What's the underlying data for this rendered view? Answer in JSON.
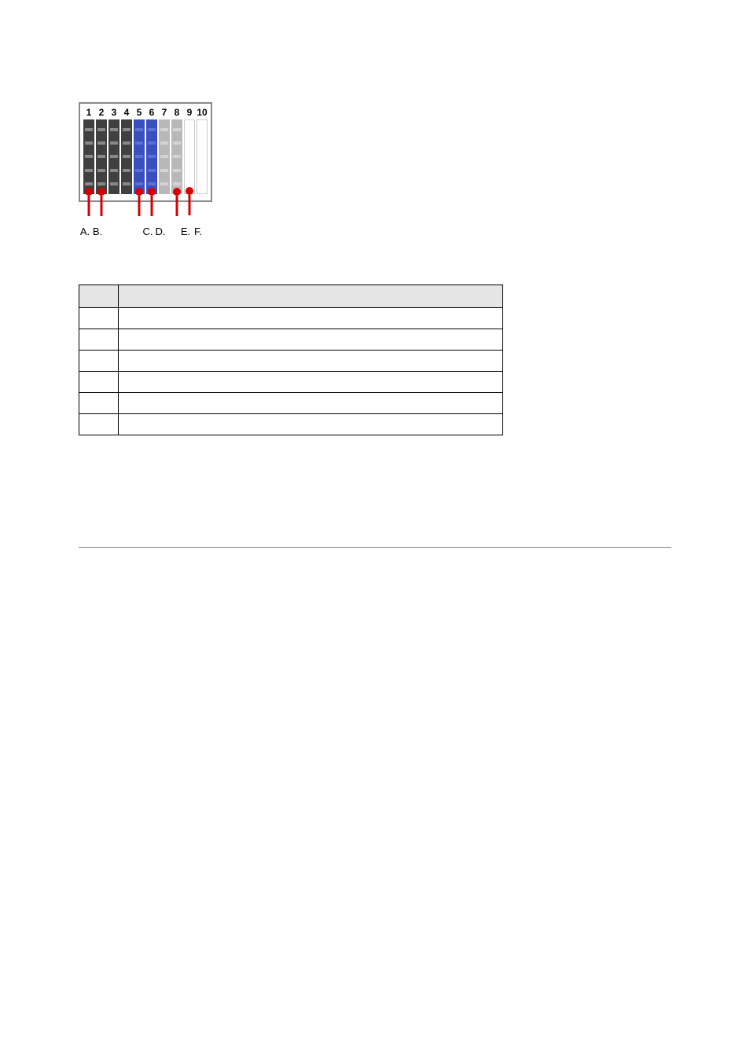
{
  "slots": [
    "1",
    "2",
    "3",
    "4",
    "5",
    "6",
    "7",
    "8",
    "9",
    "10"
  ],
  "pin_labels": {
    "a": "A.",
    "b": "B.",
    "c": "C.",
    "d": "D.",
    "e": "E.",
    "f": "F."
  },
  "table": {
    "header": [
      "",
      ""
    ],
    "rows": [
      [
        "",
        ""
      ],
      [
        "",
        ""
      ],
      [
        "",
        ""
      ],
      [
        "",
        ""
      ],
      [
        "",
        ""
      ],
      [
        "",
        ""
      ]
    ]
  }
}
